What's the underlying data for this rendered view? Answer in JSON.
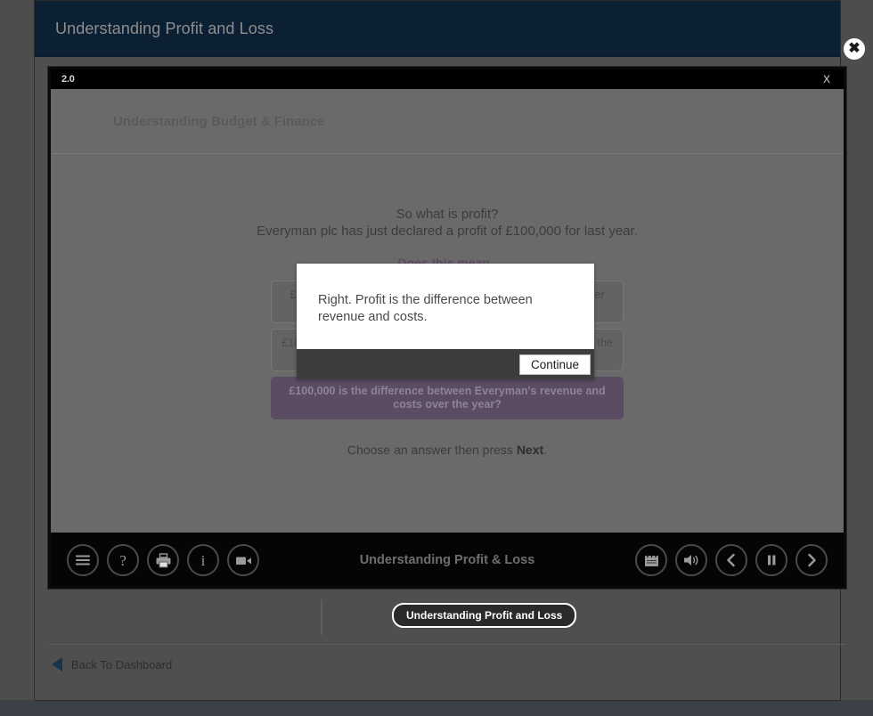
{
  "page": {
    "header_title": "Understanding Profit and Loss",
    "close_icon": "close-circle-icon",
    "background_color": "#4f4f4f",
    "header_color": "#0c2034"
  },
  "player": {
    "version_label": "2.0",
    "close_label": "X",
    "brand": "Understanding Budget & Finance",
    "footer_title": "Understanding Profit & Loss"
  },
  "slide": {
    "question_line1": "So what is profit?",
    "question_line2": "Everyman plc has just declared a profit of £100,000 for last year.",
    "prompt": "Does this mean..",
    "options": [
      {
        "text": "£100,000 was left in Everyman's bank account on 31 December 2012",
        "selected": false
      },
      {
        "text": "£100,000 is the total amount of money Everyman received over the year?",
        "selected": false
      },
      {
        "text": "£100,000 is the difference between Everyman's revenue and costs over the year?",
        "selected": true
      }
    ],
    "hint_prefix": "Choose an answer then press ",
    "hint_bold": "Next",
    "hint_suffix": ".",
    "selected_color": "#5b4b63"
  },
  "toolbar": {
    "left": [
      {
        "name": "menu-icon",
        "label": "Menu"
      },
      {
        "name": "help-icon",
        "label": "Help"
      },
      {
        "name": "print-icon",
        "label": "Print"
      },
      {
        "name": "info-icon",
        "label": "Information"
      },
      {
        "name": "video-icon",
        "label": "Video"
      }
    ],
    "right": [
      {
        "name": "notebook-icon",
        "label": "Notes"
      },
      {
        "name": "volume-icon",
        "label": "Volume"
      },
      {
        "name": "previous-icon",
        "label": "Previous"
      },
      {
        "name": "pause-icon",
        "label": "Pause"
      },
      {
        "name": "next-icon",
        "label": "Next"
      }
    ]
  },
  "lower": {
    "course_pill": "Understanding Profit and Loss",
    "back_label": "Back To Dashboard",
    "back_icon": "back-triangle-icon"
  },
  "modal": {
    "message": "Right. Profit is the difference between revenue and costs.",
    "continue_label": "Continue"
  }
}
